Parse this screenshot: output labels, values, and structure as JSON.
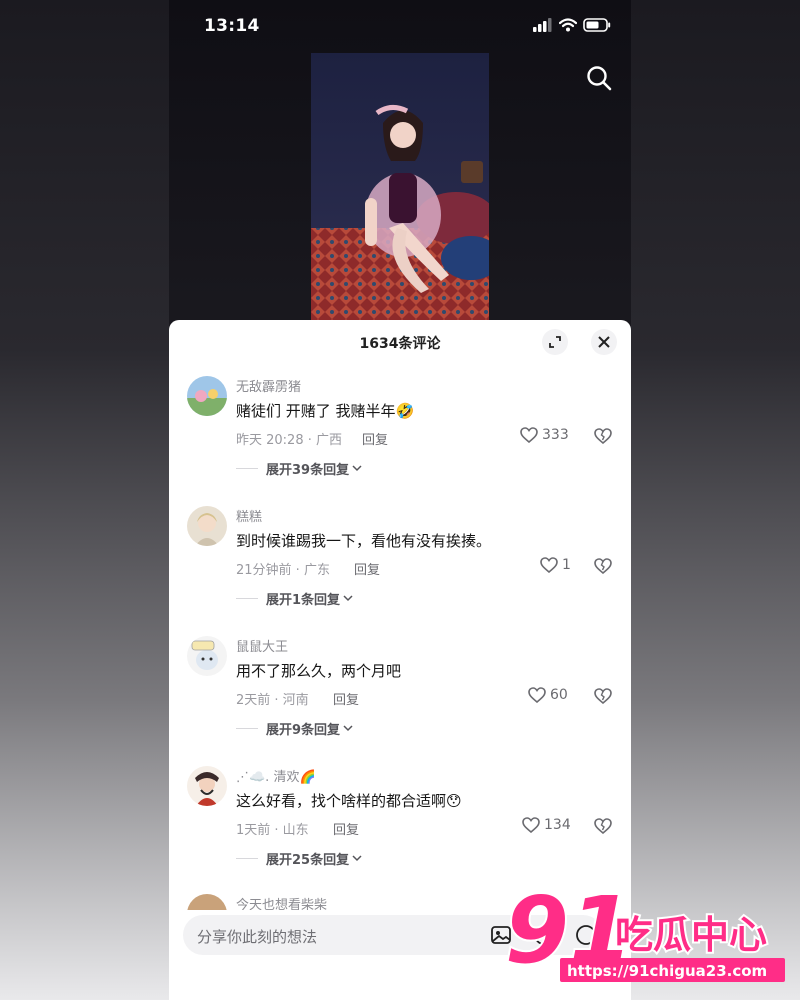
{
  "status_bar": {
    "time": "13:14"
  },
  "sheet": {
    "title": "1634条评论"
  },
  "comments": [
    {
      "user": "无敌霹雳猪",
      "text": "赌徒们 开赌了  我赌半年🤣",
      "time_location": "昨天 20:28 · 广西",
      "reply_label": "回复",
      "likes": "333",
      "expand": "展开39条回复"
    },
    {
      "user": "糕糕",
      "text": "到时候谁踢我一下，看他有没有挨揍。",
      "time_location": "21分钟前 · 广东",
      "reply_label": "回复",
      "likes": "1",
      "expand": "展开1条回复"
    },
    {
      "user": "鼠鼠大王",
      "text": "用不了那么久，两个月吧",
      "time_location": "2天前 · 河南",
      "reply_label": "回复",
      "likes": "60",
      "expand": "展开9条回复"
    },
    {
      "user": "⋰☁️. 清欢🌈",
      "text": "这么好看，找个啥样的都合适啊😯",
      "time_location": "1天前 · 山东",
      "reply_label": "回复",
      "likes": "134",
      "expand": "展开25条回复"
    }
  ],
  "partial_comment": {
    "user": "今天也想看柴柴"
  },
  "input": {
    "placeholder": "分享你此刻的想法"
  },
  "watermark": {
    "brand_number": "91",
    "brand_text": "吃瓜中心",
    "url": "https://91chigua23.com"
  },
  "colors": {
    "watermark_pink": "#ff2d87",
    "sheet_bg": "#ffffff"
  }
}
